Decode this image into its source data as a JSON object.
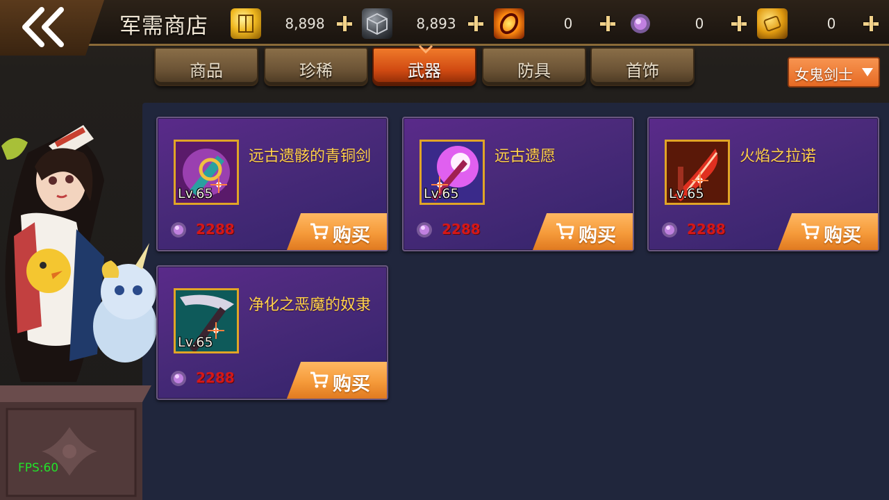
{
  "header": {
    "title": "军需商店",
    "currencies": [
      {
        "icon": "gold-cube-icon",
        "value": "8,898"
      },
      {
        "icon": "iron-cube-icon",
        "value": "8,893"
      },
      {
        "icon": "fire-ring-icon",
        "value": "0"
      },
      {
        "icon": "purple-gem-icon",
        "value": "0"
      },
      {
        "icon": "gold-coin-icon",
        "value": "0"
      }
    ]
  },
  "tabs": [
    {
      "label": "商品",
      "active": false
    },
    {
      "label": "珍稀",
      "active": false
    },
    {
      "label": "武器",
      "active": true
    },
    {
      "label": "防具",
      "active": false
    },
    {
      "label": "首饰",
      "active": false
    }
  ],
  "class_filter": {
    "selected": "女鬼剑士"
  },
  "items": [
    {
      "name": "远古遗骸的青铜剑",
      "level": "Lv.65",
      "price": "2288",
      "buy_label": "购买",
      "icon": "bronze-sword-icon"
    },
    {
      "name": "远古遗愿",
      "level": "Lv.65",
      "price": "2288",
      "buy_label": "购买",
      "icon": "light-sword-icon"
    },
    {
      "name": "火焰之拉诺",
      "level": "Lv.65",
      "price": "2288",
      "buy_label": "购买",
      "icon": "flame-blade-icon"
    },
    {
      "name": "净化之恶魔的奴隶",
      "level": "Lv.65",
      "price": "2288",
      "buy_label": "购买",
      "icon": "demon-blade-icon"
    }
  ],
  "fps": "FPS:60",
  "colors": {
    "accent": "#e66a24",
    "item_name": "#ffd24a",
    "price": "#d41818",
    "panel": "#20263c"
  }
}
